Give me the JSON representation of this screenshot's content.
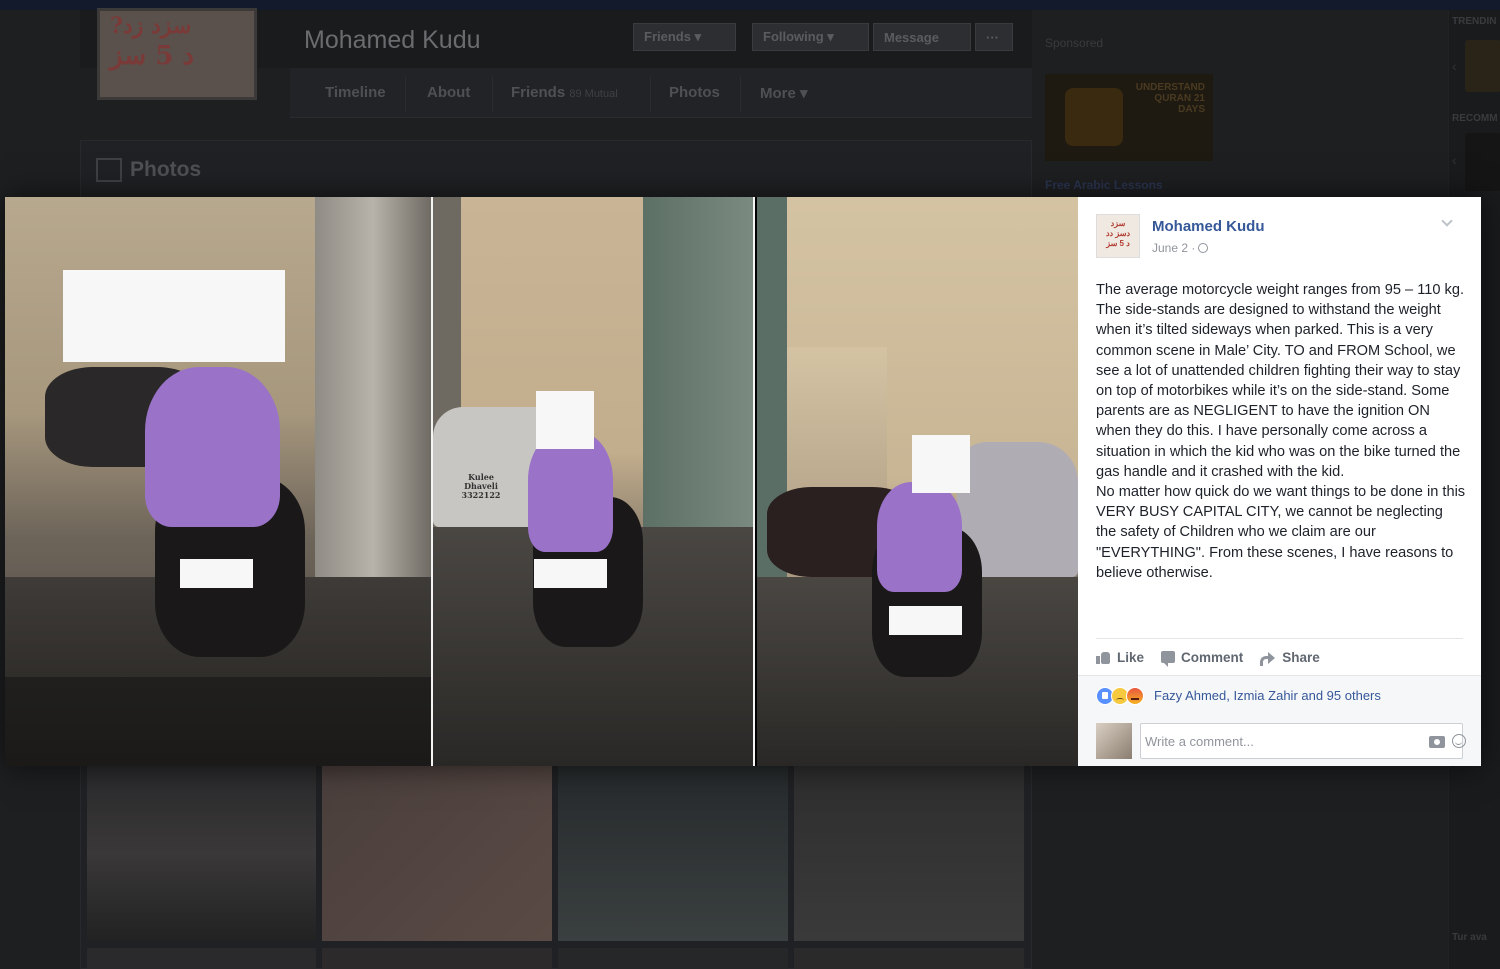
{
  "profile": {
    "name": "Mohamed Kudu",
    "buttons": {
      "friends": "Friends ▾",
      "following": "Following ▾",
      "message": "Message",
      "more": "···"
    },
    "nav": {
      "timeline": "Timeline",
      "about": "About",
      "friends": "Friends",
      "friends_sub": "89 Mutual",
      "photos": "Photos",
      "more": "More ▾"
    },
    "section_title": "Photos"
  },
  "sidebar": {
    "sponsored_label": "Sponsored",
    "ad_image_text": "UNDERSTAND QURAN 21 DAYS",
    "ad_link": "Free Arabic Lessons",
    "trending_label": "TRENDIN",
    "recommended_label": "RECOMM",
    "footer_text": "Tur ava"
  },
  "lightbox": {
    "car_sign": "Kulee Dhaveli 3322122",
    "post": {
      "author": "Mohamed Kudu",
      "date": "June 2 ·",
      "text": "The average motorcycle weight ranges from 95 – 110 kg. The side-stands are designed to withstand the weight when it’s tilted sideways when parked. This is a very common scene in Male’ City. TO and FROM School, we see a lot of unattended children fighting their way to stay on top of motorbikes while it’s on the side-stand. Some parents are as NEGLIGENT to have the ignition ON when they do this. I have personally come across a situation in which the kid who was on the bike turned the gas handle and it crashed with the kid.\nNo matter how quick do we want things to be done in this VERY BUSY CAPITAL CITY, we cannot be neglecting the safety of Children who we claim are our \"EVERYTHING\". From these scenes, I have reasons to believe otherwise.",
      "actions": {
        "like": "Like",
        "comment": "Comment",
        "share": "Share"
      },
      "reactions": [
        "like",
        "sad",
        "angry"
      ],
      "reaction_names": "Fazy Ahmed, Izmia Zahir and 95 others",
      "comment_placeholder": "Write a comment..."
    }
  }
}
